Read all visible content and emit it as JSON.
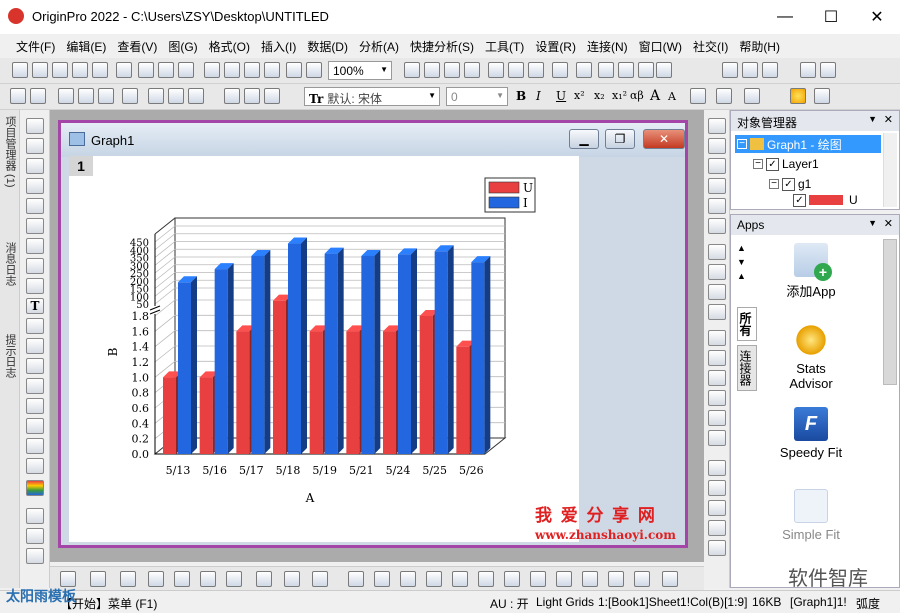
{
  "window": {
    "title": "OriginPro 2022 - C:\\Users\\ZSY\\Desktop\\UNTITLED",
    "min": "—",
    "max": "☐",
    "close": "✕"
  },
  "menu": [
    "文件(F)",
    "编辑(E)",
    "查看(V)",
    "图(G)",
    "格式(O)",
    "插入(I)",
    "数据(D)",
    "分析(A)",
    "快捷分析(S)",
    "工具(T)",
    "设置(R)",
    "连接(N)",
    "窗口(W)",
    "社交(I)",
    "帮助(H)"
  ],
  "toolbar": {
    "zoom": "100%",
    "font": "默认: 宋体",
    "font_size": "0",
    "font_styles": [
      "B",
      "I",
      "U",
      "x²",
      "x₂",
      "x₁²",
      "αβ",
      "A",
      "A"
    ]
  },
  "left_tabs": [
    "项目管理器 (1)",
    "消息日志",
    "提示日志"
  ],
  "graph": {
    "title": "Graph1",
    "layer": "1",
    "watermark1": "我 爱 分 享 网",
    "watermark2": "www.zhanshaoyi.com"
  },
  "chart_data": {
    "type": "bar",
    "style": "3D",
    "categories": [
      "5/13",
      "5/16",
      "5/17",
      "5/18",
      "5/19",
      "5/21",
      "5/24",
      "5/25",
      "5/26"
    ],
    "series": [
      {
        "name": "U",
        "color": "#e84040",
        "values": [
          1.0,
          1.0,
          1.6,
          2.0,
          1.6,
          1.6,
          1.6,
          1.8,
          1.4
        ]
      },
      {
        "name": "I",
        "color": "#2266e0",
        "values": [
          190,
          275,
          360,
          440,
          375,
          360,
          370,
          390,
          320
        ]
      }
    ],
    "xlabel": "A",
    "ylabel": "B",
    "y_lower": {
      "range": [
        0,
        1.8
      ],
      "ticks": [
        "0.0",
        "0.2",
        "0.4",
        "0.6",
        "0.8",
        "1.0",
        "1.2",
        "1.4",
        "1.6",
        "1.8"
      ]
    },
    "y_upper": {
      "range": [
        50,
        450
      ],
      "ticks": [
        "50",
        "100",
        "150",
        "200",
        "250",
        "300",
        "350",
        "400",
        "450"
      ]
    },
    "legend": "top-right"
  },
  "object_manager": {
    "title": "对象管理器",
    "items": [
      "Graph1 - 绘图",
      "Layer1",
      "g1",
      "U"
    ]
  },
  "apps": {
    "title": "Apps",
    "tabs": [
      "所有",
      "连接器"
    ],
    "items": [
      "添加App",
      "Stats Advisor",
      "Speedy Fit",
      "Simple Fit"
    ]
  },
  "status": {
    "left": "【开始】菜单 (F1)",
    "au": "AU : 开",
    "grids": "Light Grids",
    "cell": "1:[Book1]Sheet1!Col(B)[1:9]",
    "size": "16KB",
    "graph": "[Graph1]1!",
    "unit": "弧度"
  },
  "overlay": {
    "bottom_left": "太阳雨模板",
    "bottom_right": "软件智库"
  }
}
